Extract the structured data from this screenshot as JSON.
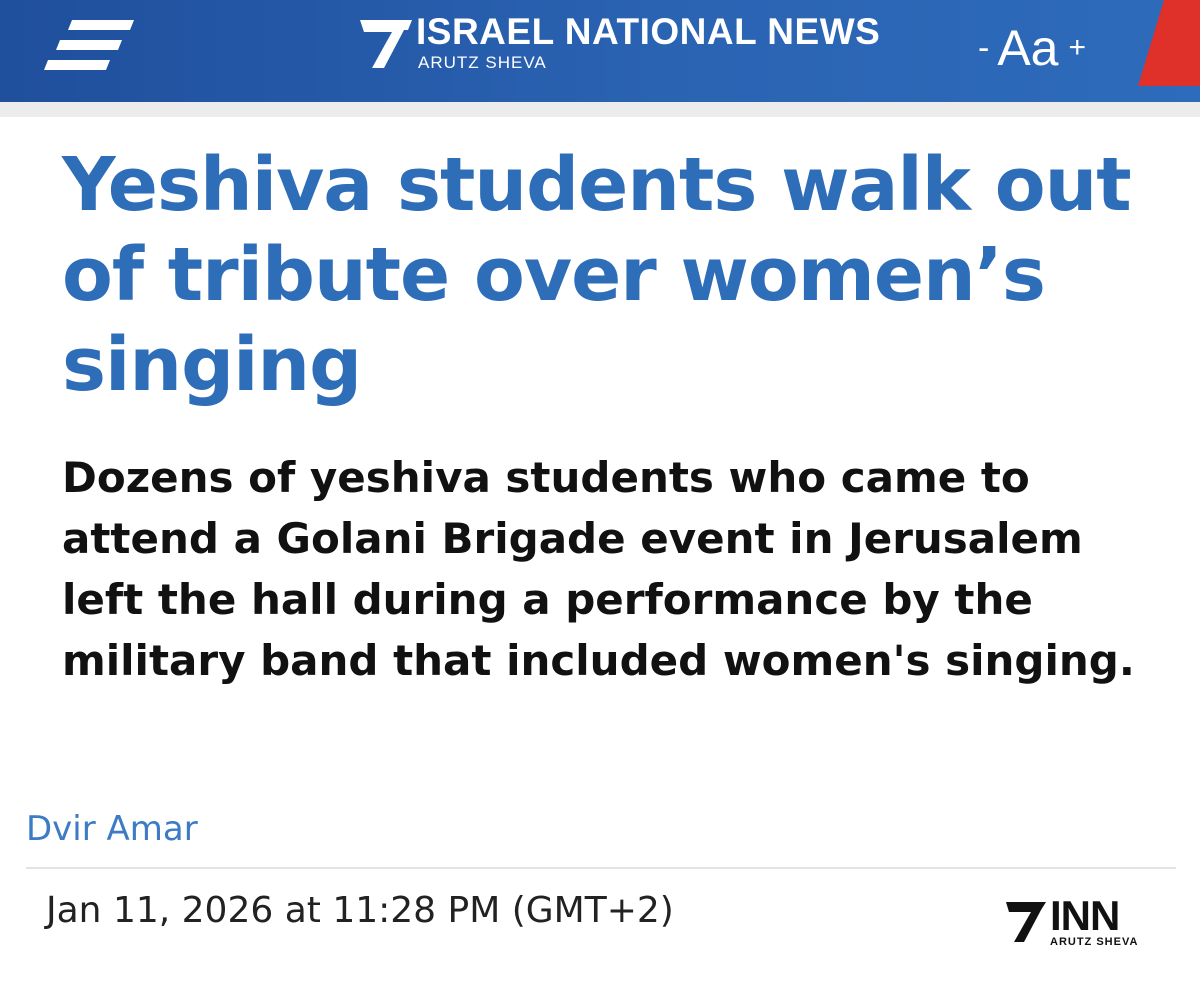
{
  "header": {
    "brand_name": "ISRAEL NATIONAL NEWS",
    "brand_sub": "ARUTZ SHEVA",
    "font_decrease_label": "-",
    "font_size_label": "Aa",
    "font_increase_label": "+",
    "menu_icon": "hamburger-menu-icon",
    "colors": {
      "bar": "#2a63b2",
      "accent_red": "#e0302a"
    }
  },
  "article": {
    "headline": "Yeshiva students walk out of tribute over women’s singing",
    "subheadline": "Dozens of yeshiva students who came to attend a Golani Brigade event in Jerusalem left the hall during a performance by the military band that included women's singing.",
    "author": "Dvir Amar",
    "date": "Jan 11, 2026 at 11:28 PM (GMT+2)",
    "colors": {
      "headline": "#2e6db8",
      "author": "#3d7bc4"
    }
  },
  "footer_logo": {
    "name": "INN",
    "sub": "ARUTZ SHEVA"
  }
}
